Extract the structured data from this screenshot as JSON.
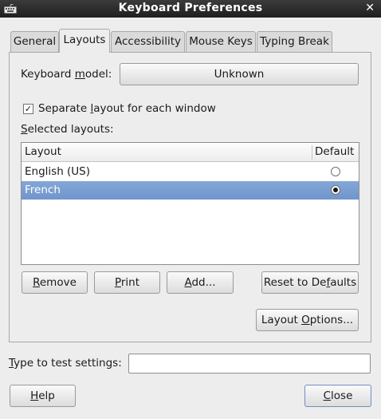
{
  "window": {
    "title": "Keyboard Preferences",
    "close_glyph": "✕",
    "app_icon": "keyboard-icon"
  },
  "tabs": [
    {
      "label": "General",
      "active": false
    },
    {
      "label": "Layouts",
      "active": true
    },
    {
      "label": "Accessibility",
      "active": false
    },
    {
      "label": "Mouse Keys",
      "active": false
    },
    {
      "label": "Typing Break",
      "active": false
    }
  ],
  "layouts_tab": {
    "keyboard_model_label_pre": "Keyboard ",
    "keyboard_model_label_u": "m",
    "keyboard_model_label_post": "odel:",
    "keyboard_model_value": "Unknown",
    "separate_layout": {
      "checked": true,
      "check_glyph": "✓",
      "label_pre": "Separate ",
      "label_u": "l",
      "label_post": "ayout for each window"
    },
    "selected_layouts_label_u": "S",
    "selected_layouts_label_post": "elected layouts:",
    "list": {
      "columns": [
        "Layout",
        "Default"
      ],
      "rows": [
        {
          "layout": "English (US)",
          "default": false,
          "selected": false
        },
        {
          "layout": "French",
          "default": true,
          "selected": true
        }
      ]
    },
    "buttons": {
      "remove": {
        "u": "R",
        "post": "emove"
      },
      "print": {
        "u": "P",
        "post": "rint"
      },
      "add": {
        "u": "A",
        "post": "dd..."
      },
      "reset": {
        "pre": "Reset to De",
        "u": "f",
        "post": "aults"
      },
      "layout_options": {
        "pre": "Layout ",
        "u": "O",
        "post": "ptions..."
      }
    }
  },
  "test_field": {
    "label_u": "T",
    "label_post": "ype to test settings:",
    "value": ""
  },
  "footer": {
    "help": {
      "u": "H",
      "post": "elp"
    },
    "close": {
      "u": "C",
      "post": "lose"
    }
  },
  "colors": {
    "selection": "#7b9fd3",
    "background": "#ededed",
    "titlebar": "#2b2b2b"
  }
}
